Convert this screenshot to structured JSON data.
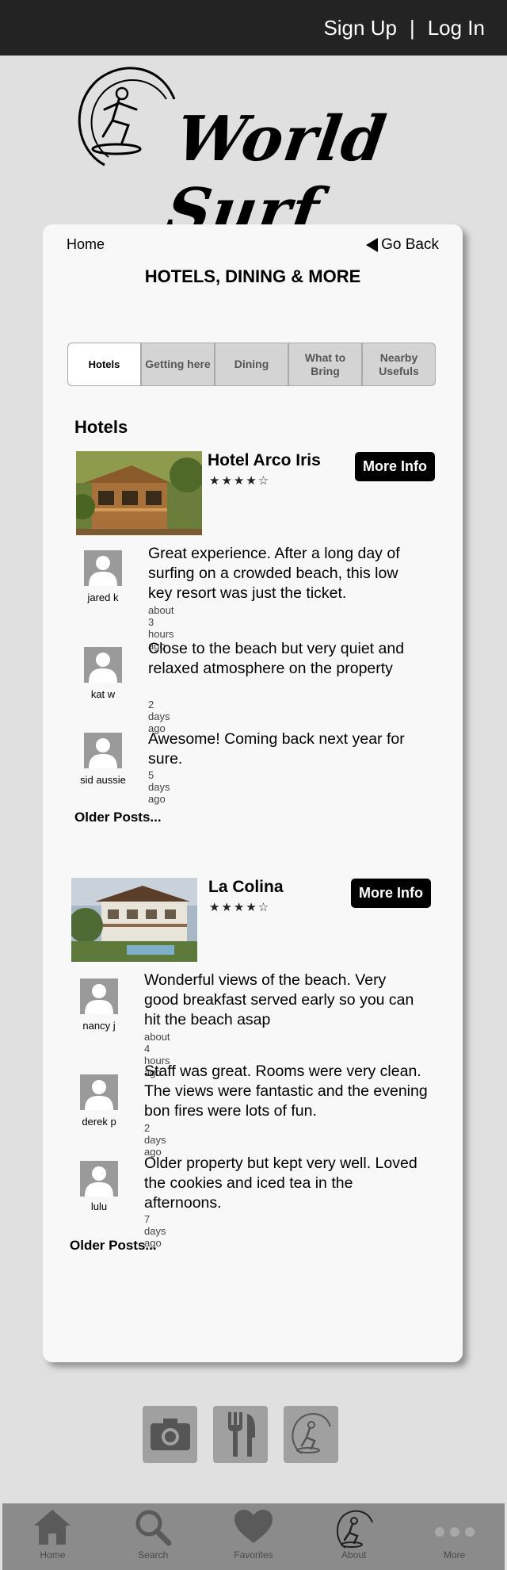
{
  "header": {
    "signup_label": "Sign Up",
    "separator": "|",
    "login_label": "Log In"
  },
  "logo": {
    "text": "World Surf",
    "icon": "surfer-logo-icon"
  },
  "nav": {
    "home_label": "Home",
    "goback_label": "Go Back"
  },
  "page_title": "HOTELS, DINING & MORE",
  "tabs": [
    {
      "label": "Hotels",
      "active": true
    },
    {
      "label": "Getting here",
      "active": false
    },
    {
      "label": "Dining",
      "active": false
    },
    {
      "label": "What to Bring",
      "active": false
    },
    {
      "label": "Nearby Usefuls",
      "active": false
    }
  ],
  "section_heading": "Hotels",
  "hotels": [
    {
      "name": "Hotel Arco Iris",
      "stars": "★★★★☆",
      "rating": 4,
      "more_info_label": "More Info",
      "reviews": [
        {
          "user": "jared k",
          "text": "Great experience. After a long day of surfing on a crowded beach, this low key resort was just the ticket.",
          "time": "about 3 hours ago"
        },
        {
          "user": "kat w",
          "text": "Close to the beach but very quiet and relaxed atmosphere on the property",
          "time": "2 days ago"
        },
        {
          "user": "sid aussie",
          "text": "Awesome! Coming back next year for sure.",
          "time": "5 days ago"
        }
      ],
      "older_label": "Older Posts..."
    },
    {
      "name": "La Colina",
      "stars": "★★★★☆",
      "rating": 4,
      "more_info_label": "More Info",
      "reviews": [
        {
          "user": "nancy j",
          "text": "Wonderful views of the beach. Very good breakfast served early so you can hit the beach asap",
          "time": "about 4 hours ago"
        },
        {
          "user": "derek p",
          "text": "Staff was great.  Rooms were very clean. The views were fantastic and the evening bon fires were lots of fun.",
          "time": "2 days ago"
        },
        {
          "user": "lulu",
          "text": "Older property but kept very well. Loved the cookies and iced tea in the afternoons.",
          "time": "7 days ago"
        }
      ],
      "older_label": "Older Posts..."
    }
  ],
  "quick_icons": [
    "camera-icon",
    "dining-icon",
    "surfer-logo-icon"
  ],
  "bottom_nav": [
    {
      "label": "Home",
      "icon": "home-icon"
    },
    {
      "label": "Search",
      "icon": "search-icon"
    },
    {
      "label": "Favorites",
      "icon": "heart-icon"
    },
    {
      "label": "About",
      "icon": "surfer-logo-icon"
    },
    {
      "label": "More",
      "icon": "more-dots-icon"
    }
  ],
  "colors": {
    "topbar": "#232323",
    "background": "#e0e0e0",
    "card": "#f8f8f8",
    "button": "#000000",
    "bottom_nav": "#8b8b8b"
  }
}
